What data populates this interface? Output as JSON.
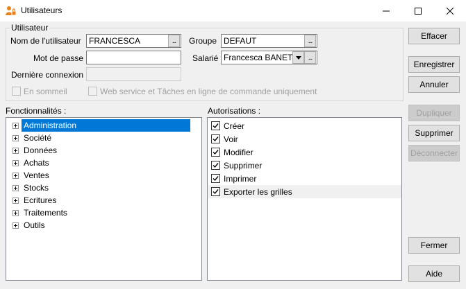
{
  "window": {
    "title": "Utilisateurs",
    "controls": {
      "minimize": "—",
      "maximize": "☐",
      "close": "✕"
    }
  },
  "user_group": {
    "legend": "Utilisateur",
    "username_label": "Nom de l'utilisateur",
    "username_value": "FRANCESCA",
    "password_label": "Mot de passe",
    "password_value": "",
    "last_login_label": "Dernière connexion",
    "last_login_value": "",
    "group_label": "Groupe",
    "group_value": "DEFAUT",
    "employee_label": "Salarié",
    "employee_value": "Francesca BANET",
    "ellipsis": "...",
    "sleep_label": "En sommeil",
    "webservice_label": "Web service et Tâches en ligne de commande uniquement"
  },
  "features": {
    "label": "Fonctionnalités :",
    "items": [
      "Administration",
      "Société",
      "Données",
      "Achats",
      "Ventes",
      "Stocks",
      "Ecritures",
      "Traitements",
      "Outils"
    ],
    "selected": "Administration"
  },
  "permissions": {
    "label": "Autorisations :",
    "items": [
      "Créer",
      "Voir",
      "Modifier",
      "Supprimer",
      "Imprimer",
      "Exporter les grilles"
    ]
  },
  "buttons": {
    "effacer": "Effacer",
    "enregistrer": "Enregistrer",
    "annuler": "Annuler",
    "dupliquer": "Dupliquer",
    "supprimer": "Supprimer",
    "deconnecter": "Déconnecter",
    "fermer": "Fermer",
    "aide": "Aide"
  },
  "colors": {
    "selection": "#0078d7",
    "accent_icon": "#e8811a"
  }
}
